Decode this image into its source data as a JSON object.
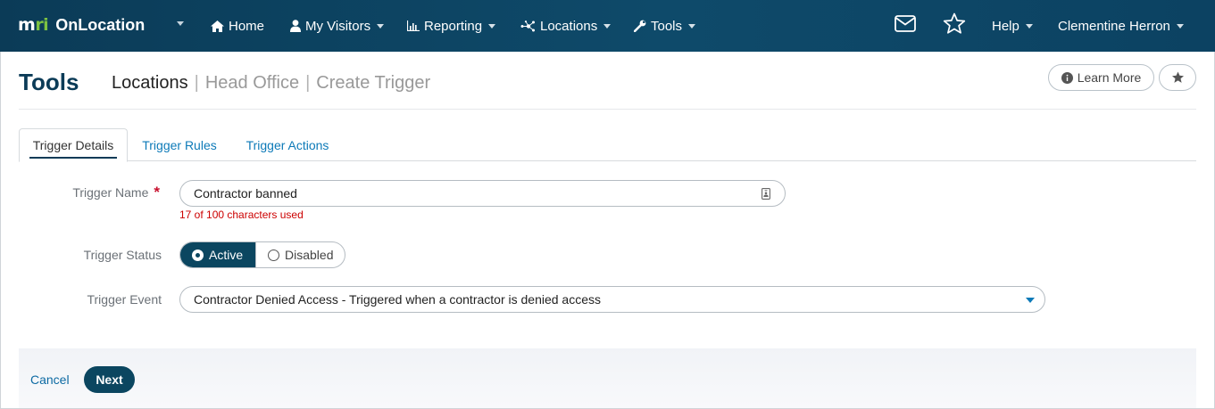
{
  "brand": {
    "logo_text_a": "m",
    "logo_text_b": "ri",
    "name": "OnLocation"
  },
  "nav": {
    "home": "Home",
    "visitors": "My Visitors",
    "reporting": "Reporting",
    "locations": "Locations",
    "tools": "Tools",
    "help": "Help",
    "user": "Clementine Herron"
  },
  "icons": {
    "home": "home-icon",
    "visitors": "user-icon",
    "reporting": "bar-chart-icon",
    "locations": "network-icon",
    "tools": "wrench-icon",
    "mail": "envelope-icon",
    "favorite": "star-icon",
    "info": "info-icon",
    "field": "id-card-icon"
  },
  "header": {
    "title": "Tools",
    "breadcrumb": {
      "current": "Locations",
      "item2": "Head Office",
      "item3": "Create Trigger",
      "separator": "|"
    },
    "learn_more": "Learn More"
  },
  "tabs": [
    "Trigger Details",
    "Trigger Rules",
    "Trigger Actions"
  ],
  "form": {
    "name_label": "Trigger Name",
    "required_mark": "*",
    "name_value": "Contractor banned",
    "counter": "17 of 100 characters used",
    "status_label": "Trigger Status",
    "status_active": "Active",
    "status_disabled": "Disabled",
    "status_selected": "Active",
    "event_label": "Trigger Event",
    "event_value": "Contractor Denied Access - Triggered when a contractor is denied access"
  },
  "footer": {
    "cancel": "Cancel",
    "next": "Next"
  },
  "colors": {
    "nav_bg": "#0b3b57",
    "primary": "#0b4660",
    "link": "#0d7ab8",
    "error": "#cc0000",
    "logo_accent": "#7cc242"
  }
}
